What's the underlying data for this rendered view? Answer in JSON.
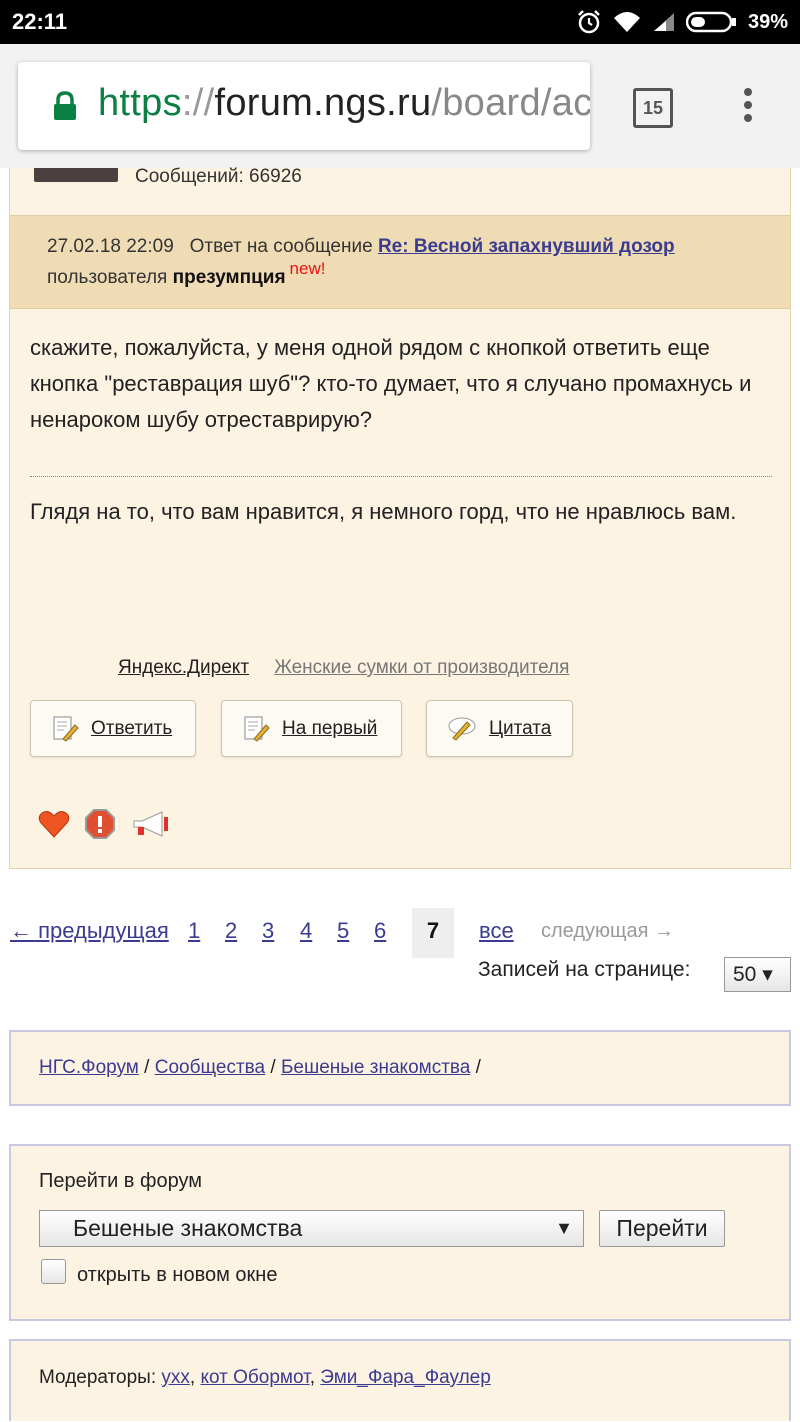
{
  "status_bar": {
    "time": "22:11",
    "battery": "39%"
  },
  "browser": {
    "url_scheme": "https",
    "url_sep": "://",
    "url_host": "forum.ngs.ru",
    "url_path": "/board/ac",
    "tab_count": "15"
  },
  "post": {
    "message_count": "Сообщений: 66926",
    "date": "27.02.18 22:09",
    "reply_prefix": "Ответ на сообщение",
    "reply_link": "Re: Весной запахнувший дозор",
    "user_prefix": "пользователя",
    "username": "презумпция",
    "new_badge": "new!",
    "body": "скажите, пожалуйста, у меня одной рядом с кнопкой ответить еще кнопка \"реставрация шуб\"? кто-то думает, что я случано промахнусь и ненароком шубу отреставрирую?",
    "signature": "Глядя на то, что вам нравится, я немного горд, что не нравлюсь вам.",
    "ad_source": "Яндекс.Директ",
    "ad_link": "Женские сумки от производителя",
    "buttons": {
      "reply": "Ответить",
      "to_first": "На первый",
      "quote": "Цитата"
    }
  },
  "pagination": {
    "prev": "← предыдущая",
    "pages": [
      "1",
      "2",
      "3",
      "4",
      "5",
      "6"
    ],
    "current": "7",
    "all": "все",
    "next": "следующая →",
    "per_page_label": "Записей на странице:",
    "per_page_value": "50 ▾"
  },
  "breadcrumb": {
    "items": [
      "НГС.Форум",
      "Сообщества",
      "Бешеные знакомства"
    ],
    "sep": " / ",
    "trailing": " /"
  },
  "jump": {
    "label": "Перейти в форум",
    "selected": "Бешеные знакомства",
    "arrow": "▼",
    "button": "Перейти",
    "checkbox_label": "открыть в новом окне"
  },
  "moderators": {
    "label": "Модераторы: ",
    "names": [
      "ухх",
      "кот Обормот",
      "Эми_Фара_Фаулер"
    ],
    "sep": ", "
  }
}
